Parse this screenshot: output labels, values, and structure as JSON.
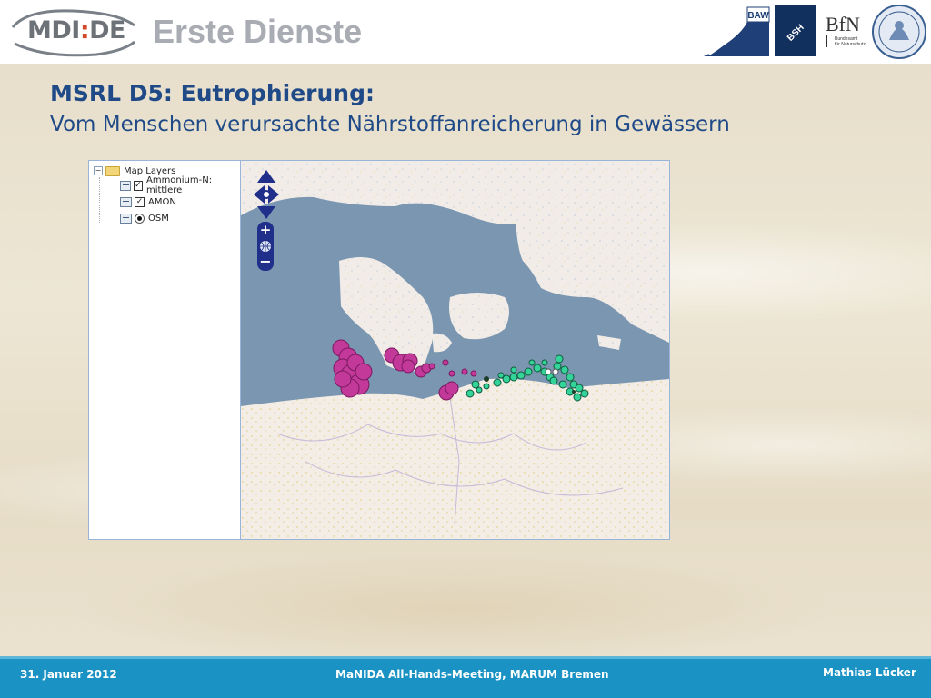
{
  "header": {
    "logo_text": "MDI",
    "logo_text_2": "DE",
    "slide_title": "Erste Dienste",
    "partner_logos": {
      "baw": "BAW",
      "bsh": "BSH",
      "bfn": "BfN",
      "bfn_caption_1": "Bundesamt",
      "bfn_caption_2": "für Naturschutz"
    }
  },
  "content": {
    "heading": "MSRL D5: Eutrophierung:",
    "subheading": "Vom Menschen verursachte Nährstoffanreicherung in Gewässern"
  },
  "map_app": {
    "layer_tree": {
      "root_label": "Map Layers",
      "layers": [
        {
          "label": "Ammonium-N: mittlere",
          "checked": true,
          "type": "checkbox"
        },
        {
          "label": "AMON",
          "checked": true,
          "type": "checkbox"
        },
        {
          "label": "OSM",
          "checked": true,
          "type": "radio"
        }
      ]
    },
    "colors": {
      "sea": "#7b96b1",
      "land": "#f2ece8",
      "magenta_points": "#c2399a",
      "green_points": "#34d39a"
    }
  },
  "footer": {
    "date": "31. Januar 2012",
    "meeting": "MaNIDA All-Hands-Meeting, MARUM Bremen",
    "author": "Mathias Lücker"
  }
}
